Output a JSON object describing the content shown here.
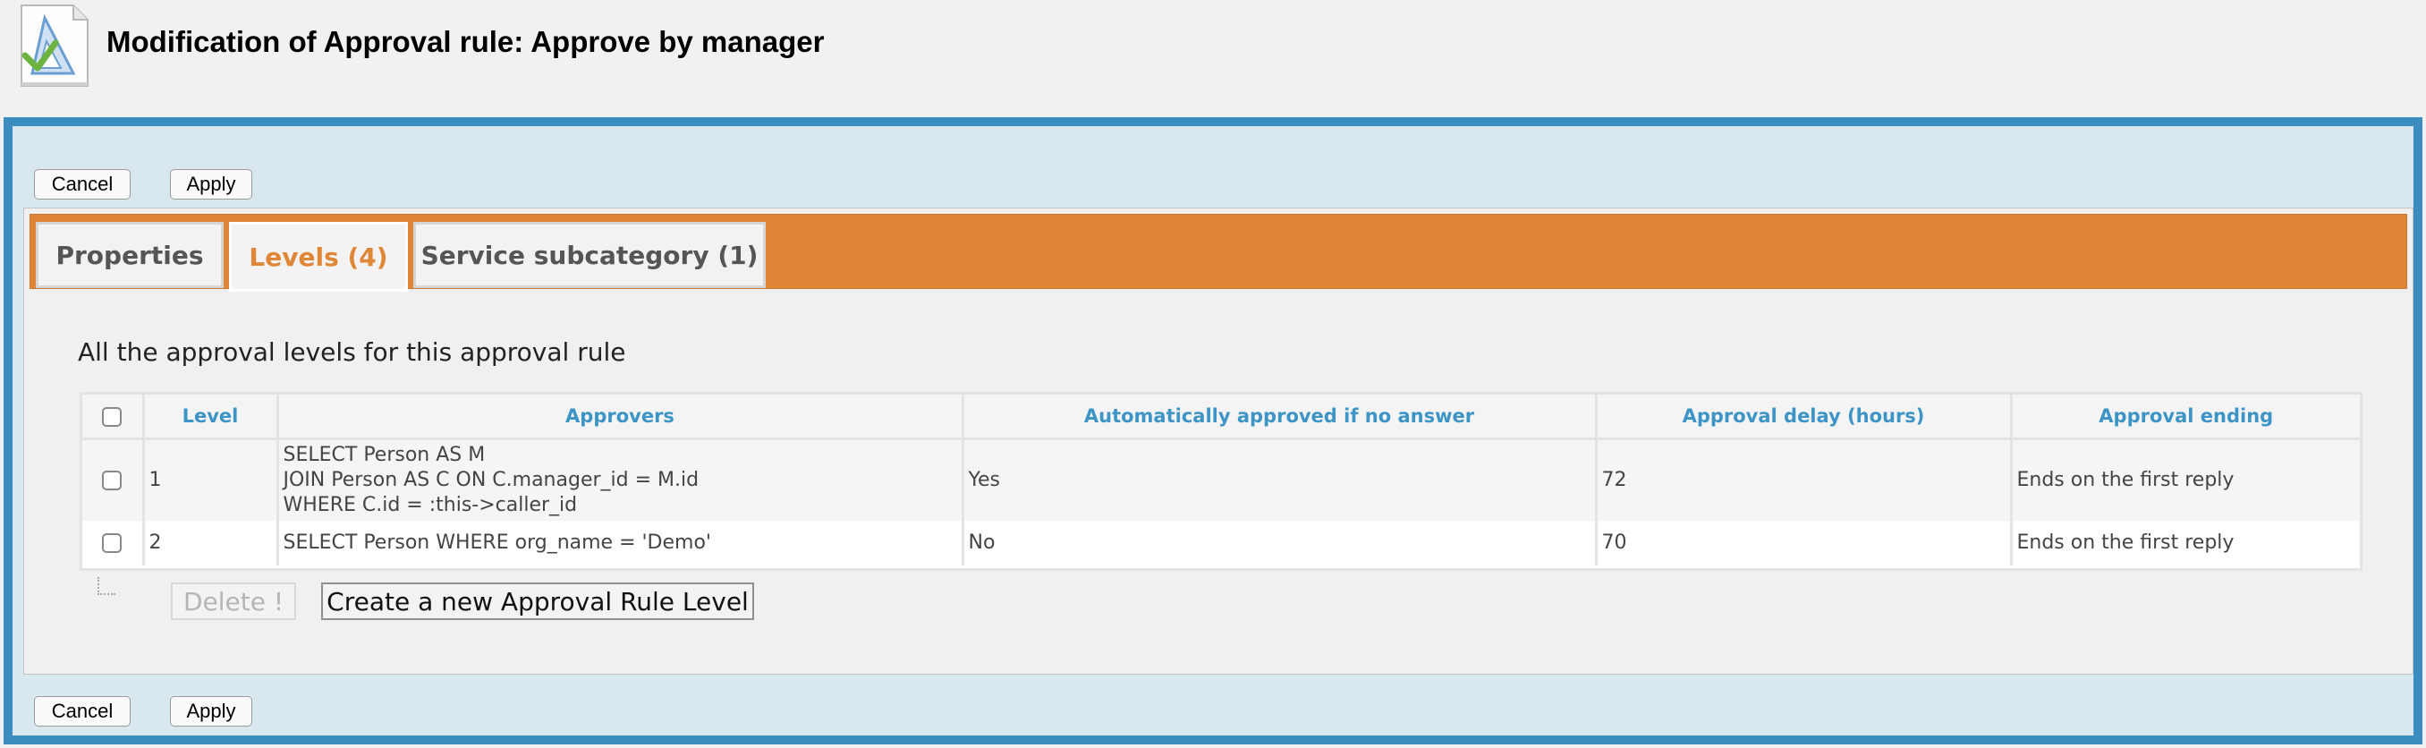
{
  "header": {
    "icon": "approval-rule-icon",
    "title": "Modification of Approval rule: Approve by manager"
  },
  "actions": {
    "cancel_label": "Cancel",
    "apply_label": "Apply"
  },
  "tabs": [
    {
      "label": "Properties",
      "active": false
    },
    {
      "label": "Levels (4)",
      "active": true
    },
    {
      "label": "Service subcategory (1)",
      "active": false
    }
  ],
  "levels_section": {
    "title": "All the approval levels for this approval rule",
    "columns": [
      "Level",
      "Approvers",
      "Automatically approved if no answer",
      "Approval delay (hours)",
      "Approval ending"
    ],
    "rows": [
      {
        "level": "1",
        "approvers_lines": [
          "SELECT Person AS M",
          "JOIN Person AS C ON C.manager_id = M.id",
          "WHERE C.id = :this->caller_id"
        ],
        "auto_approved": "Yes",
        "delay": "72",
        "ending": "Ends on the first reply"
      },
      {
        "level": "2",
        "approvers_lines": [
          "SELECT Person WHERE org_name = 'Demo'"
        ],
        "auto_approved": "No",
        "delay": "70",
        "ending": "Ends on the first reply"
      }
    ],
    "delete_label": "Delete !",
    "create_label": "Create a new Approval Rule Level"
  },
  "colors": {
    "frame_border": "#3c8dbf",
    "frame_bg": "#d9e8ef",
    "tabbar": "#e08637",
    "header_text": "#3d94c6"
  }
}
